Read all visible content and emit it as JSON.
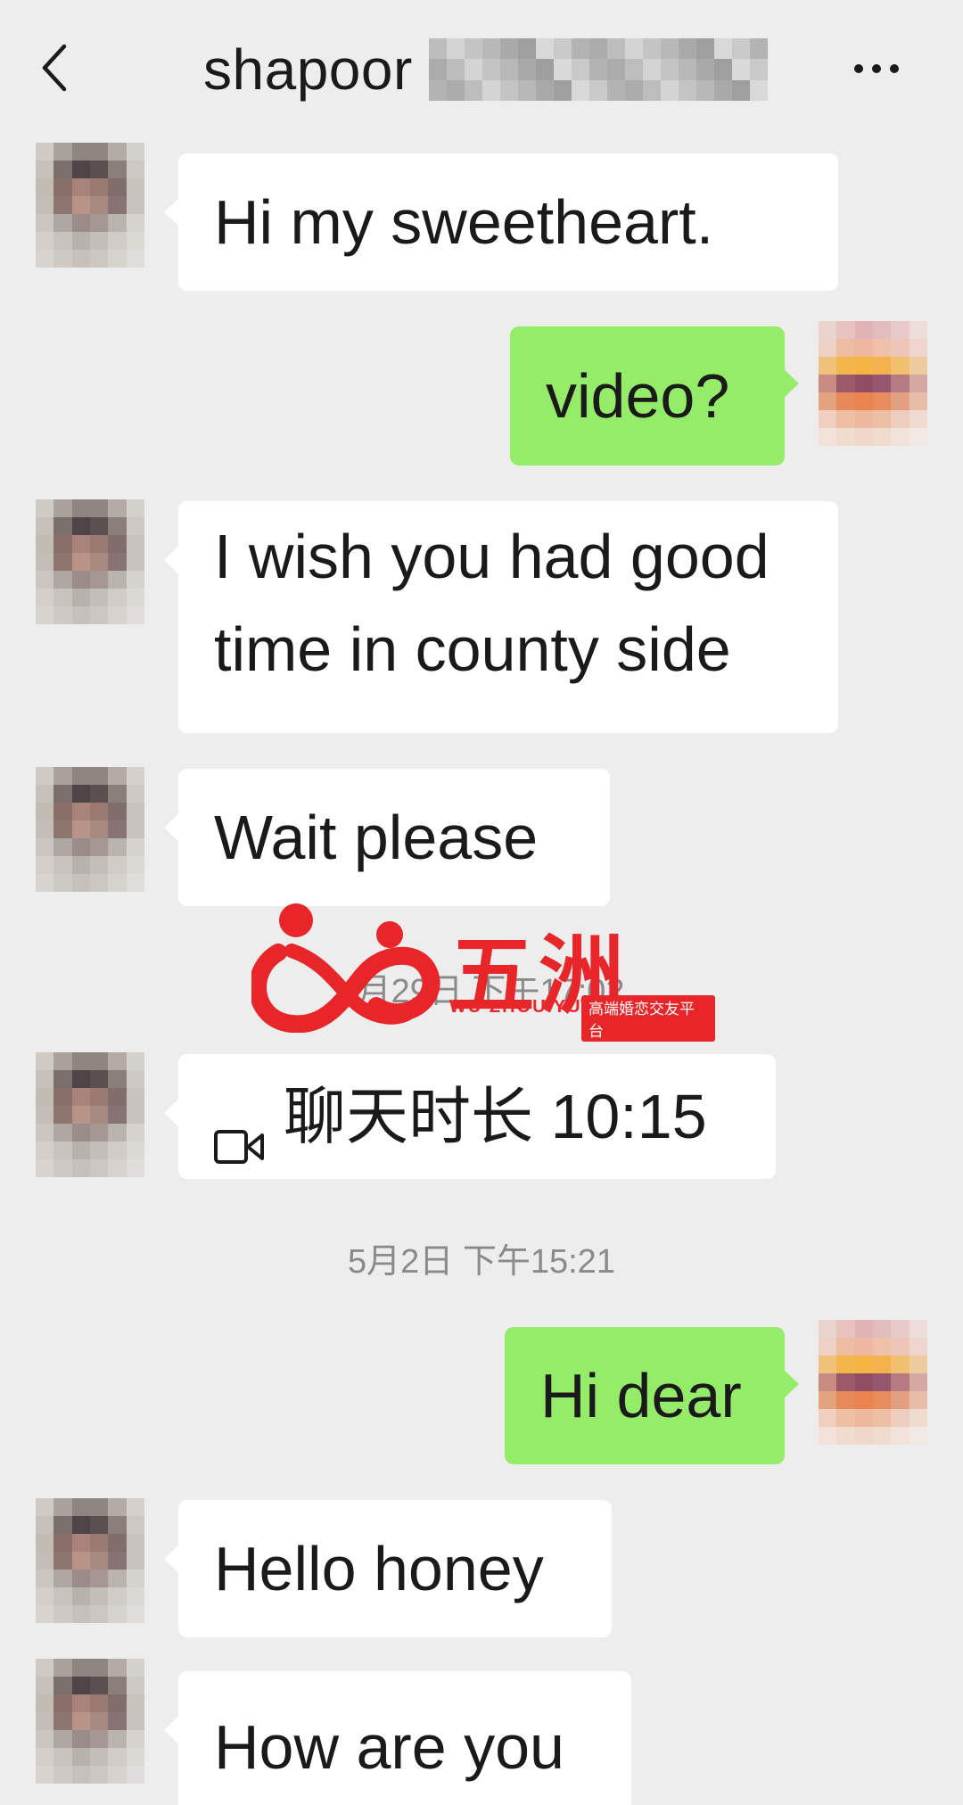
{
  "header": {
    "title": "shapoor",
    "back_icon": "chevron-left-icon",
    "more_icon": "ellipsis-icon"
  },
  "messages": [
    {
      "side": "left",
      "text": "Hi my sweetheart."
    },
    {
      "side": "right",
      "text": "video?"
    },
    {
      "side": "left",
      "lines": [
        "I wish you had good",
        "time in county side"
      ]
    },
    {
      "side": "left",
      "text": "Wait please"
    },
    {
      "type": "timestamp",
      "text": "4月29日 下午17:02"
    },
    {
      "side": "left",
      "type": "call",
      "text": "聊天时长 10:15",
      "icon": "video-call-icon"
    },
    {
      "type": "timestamp",
      "text": "5月2日 下午15:21"
    },
    {
      "side": "right",
      "text": "Hi dear"
    },
    {
      "side": "left",
      "text": "Hello honey"
    },
    {
      "side": "left",
      "text": "How are you"
    }
  ],
  "watermark": {
    "title": "五洲缘",
    "subtitle_left": "WU ZHOU YUAN",
    "subtitle_right": "高端婚恋交友平台",
    "color": "#e8262a"
  },
  "colors": {
    "background": "#ededed",
    "incoming_bubble": "#ffffff",
    "outgoing_bubble": "#95ec69"
  }
}
